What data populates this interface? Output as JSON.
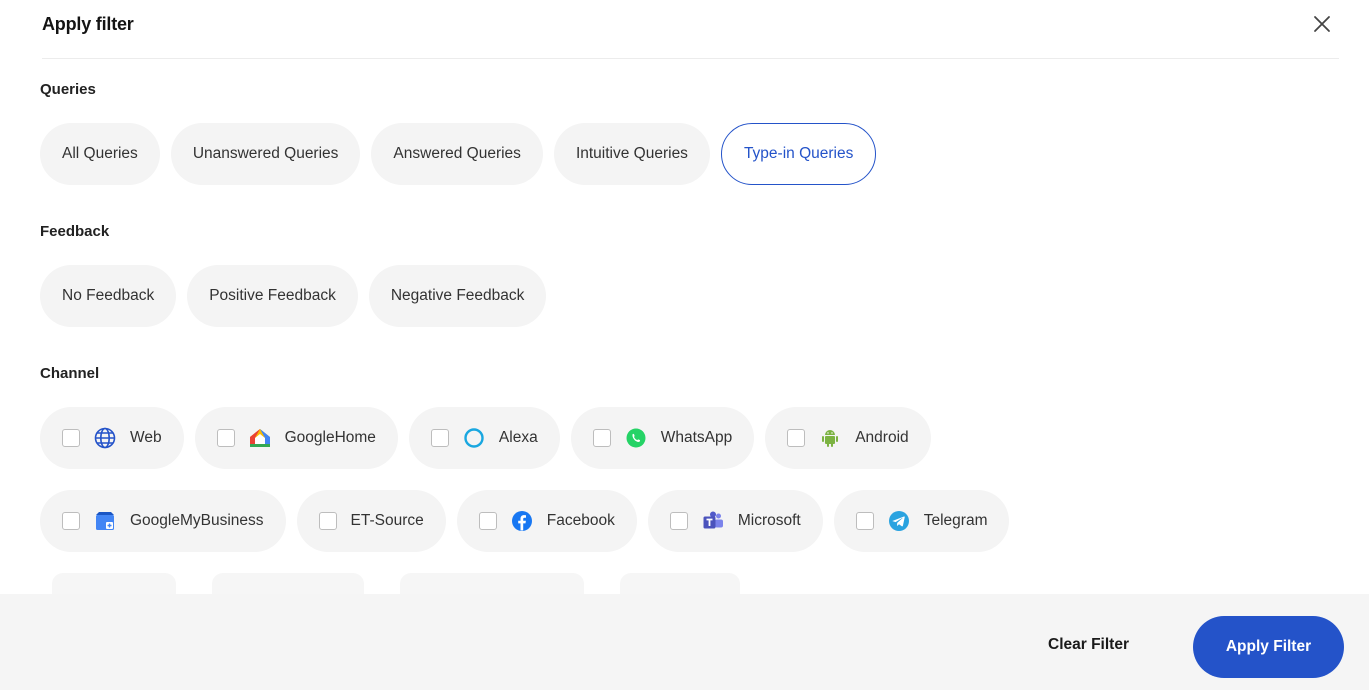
{
  "header": {
    "title": "Apply filter",
    "close_icon": "close-icon"
  },
  "queries": {
    "label": "Queries",
    "options": [
      {
        "label": "All Queries",
        "selected": false
      },
      {
        "label": "Unanswered Queries",
        "selected": false
      },
      {
        "label": "Answered Queries",
        "selected": false
      },
      {
        "label": "Intuitive Queries",
        "selected": false
      },
      {
        "label": "Type-in Queries",
        "selected": true
      }
    ]
  },
  "feedback": {
    "label": "Feedback",
    "options": [
      {
        "label": "No Feedback"
      },
      {
        "label": "Positive Feedback"
      },
      {
        "label": "Negative Feedback"
      }
    ]
  },
  "channel": {
    "label": "Channel",
    "rows": [
      [
        {
          "label": "Web",
          "icon": "globe-icon",
          "checked": false
        },
        {
          "label": "GoogleHome",
          "icon": "google-home-icon",
          "checked": false
        },
        {
          "label": "Alexa",
          "icon": "alexa-icon",
          "checked": false
        },
        {
          "label": "WhatsApp",
          "icon": "whatsapp-icon",
          "checked": false
        },
        {
          "label": "Android",
          "icon": "android-icon",
          "checked": false
        }
      ],
      [
        {
          "label": "GoogleMyBusiness",
          "icon": "google-my-business-icon",
          "checked": false
        },
        {
          "label": "ET-Source",
          "icon": "",
          "checked": false
        },
        {
          "label": "Facebook",
          "icon": "facebook-icon",
          "checked": false
        },
        {
          "label": "Microsoft",
          "icon": "microsoft-teams-icon",
          "checked": false
        },
        {
          "label": "Telegram",
          "icon": "telegram-icon",
          "checked": false
        }
      ]
    ]
  },
  "footer": {
    "clear_label": "Clear Filter",
    "apply_label": "Apply Filter"
  },
  "colors": {
    "accent": "#2453c9",
    "chip_bg": "#f4f4f4",
    "footer_bg": "#f5f5f5"
  }
}
